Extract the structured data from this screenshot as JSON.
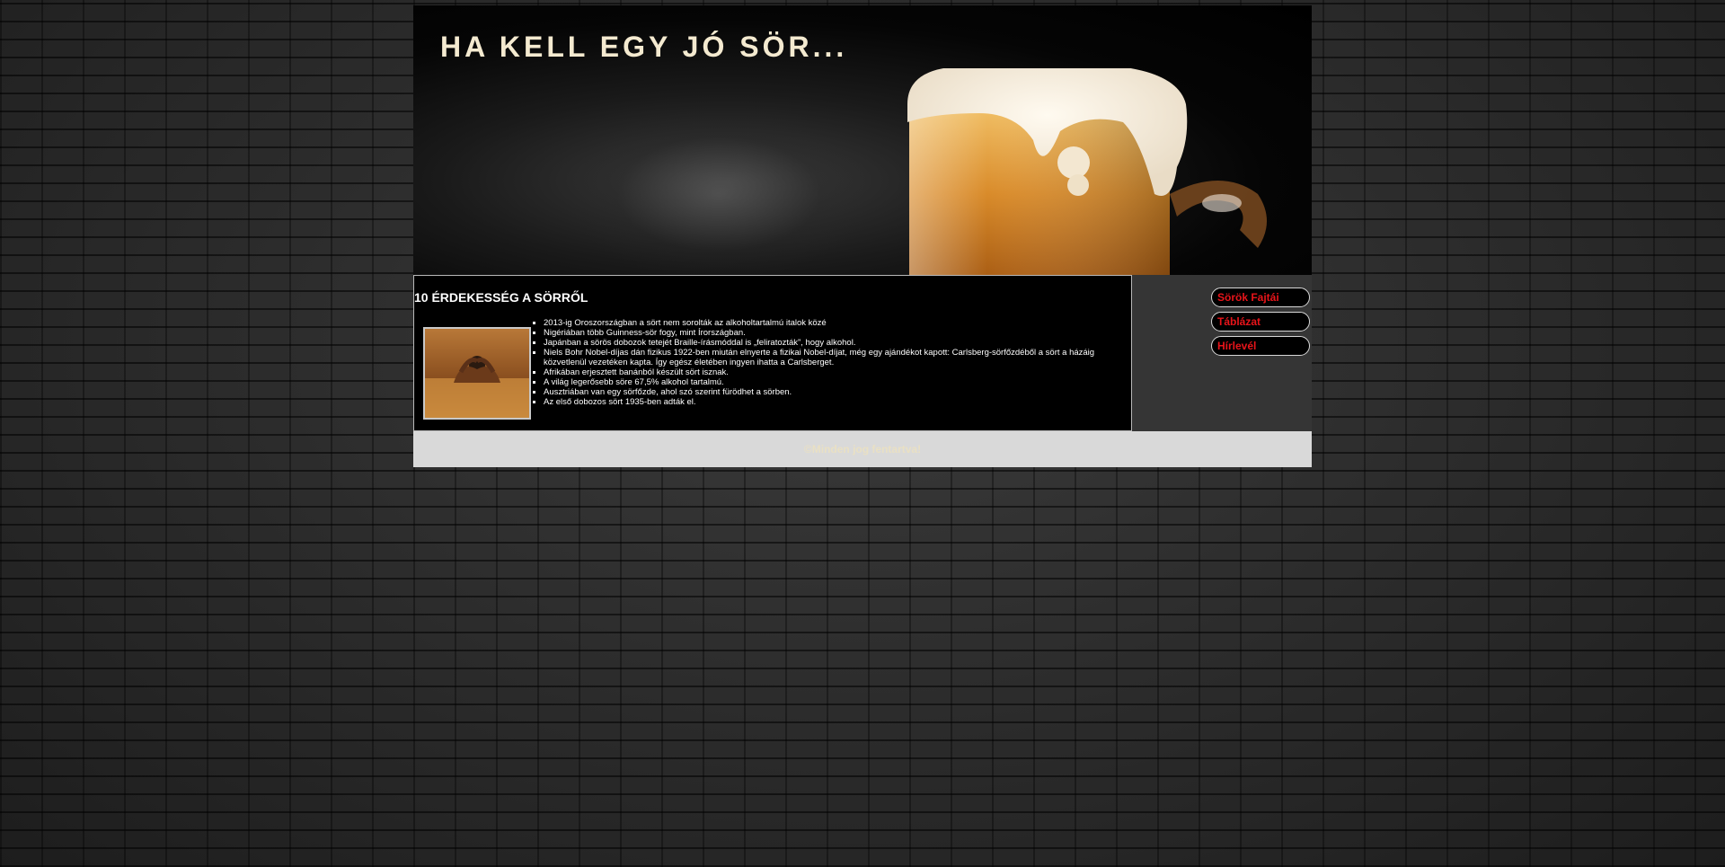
{
  "header": {
    "title": "HA KELL EGY JÓ SÖR..."
  },
  "main": {
    "heading": "10 ÉRDEKESSÉG A SÖRRŐL",
    "image_icon": "bathing-in-beer-photo",
    "facts": [
      "2013-ig Oroszországban a sört nem sorolták az alkoholtartalmú italok közé",
      "Nigériában több Guinness-sör fogy, mint Írországban.",
      "Japánban a sörös dobozok tetejét Braille-írásmóddal is „feliratozták”, hogy alkohol.",
      "Niels Bohr Nobel-díjas dán fizikus 1922-ben miután elnyerte a fizikai Nobel-díjat, még egy ajándékot kapott: Carlsberg-sörfőzdéből a sört a házáig közvetlenül vezetéken kapta. Így egész életében ingyen ihatta a Carlsberget.",
      "Afrikában erjesztett banánból készült sört isznak.",
      "A világ legerősebb söre 67,5% alkohol tartalmú.",
      "Ausztriában van egy sörfőzde, ahol szó szerint fürödhet a sörben.",
      "Az első dobozos sört 1935-ben adták el."
    ]
  },
  "sidebar": {
    "items": [
      {
        "label": "Sörök Fajtái"
      },
      {
        "label": "Táblázat"
      },
      {
        "label": "Hírlevél"
      }
    ]
  },
  "footer": {
    "text": "©Minden jog fentartva!"
  },
  "colors": {
    "nav_text": "#e8141a",
    "title_text": "#f4ead0",
    "footer_bg": "#d9d9d9",
    "sidebar_bg": "#353535"
  }
}
